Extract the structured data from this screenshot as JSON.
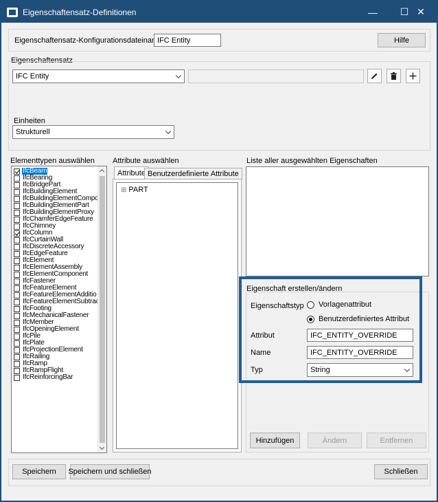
{
  "window": {
    "title": "Eigenschaftensatz-Definitionen",
    "minimize": "—",
    "maximize": "☐",
    "close": "✕"
  },
  "config": {
    "label": "Eigenschaftensatz-Konfigurationsdateiname",
    "value": "IFC Entity",
    "help_button": "Hilfe"
  },
  "propertyset": {
    "group_label": "Eigenschaftensatz",
    "selected": "IFC Entity",
    "text_value": ""
  },
  "units": {
    "group_label": "Einheiten",
    "selected": "Strukturell"
  },
  "element_types": {
    "label": "Elementtypen auswählen",
    "items": [
      {
        "name": "IfcBeam",
        "checked": true,
        "selected": true
      },
      {
        "name": "IfcBearing",
        "checked": false
      },
      {
        "name": "IfcBridgePart",
        "checked": false
      },
      {
        "name": "IfcBuildingElement",
        "checked": false
      },
      {
        "name": "IfcBuildingElementCompo",
        "checked": false
      },
      {
        "name": "IfcBuildingElementPart",
        "checked": false
      },
      {
        "name": "IfcBuildingElementProxy",
        "checked": false
      },
      {
        "name": "IfcChamferEdgeFeature",
        "checked": false
      },
      {
        "name": "IfcChimney",
        "checked": false
      },
      {
        "name": "IfcColumn",
        "checked": true
      },
      {
        "name": "IfcCurtainWall",
        "checked": false
      },
      {
        "name": "IfcDiscreteAccessory",
        "checked": false
      },
      {
        "name": "IfcEdgeFeature",
        "checked": false
      },
      {
        "name": "IfcElement",
        "checked": false
      },
      {
        "name": "IfcElementAssembly",
        "checked": false
      },
      {
        "name": "IfcElementComponent",
        "checked": false
      },
      {
        "name": "IfcFastener",
        "checked": false
      },
      {
        "name": "IfcFeatureElement",
        "checked": false
      },
      {
        "name": "IfcFeatureElementAdditio",
        "checked": false
      },
      {
        "name": "IfcFeatureElementSubtrac",
        "checked": false
      },
      {
        "name": "IfcFooting",
        "checked": false
      },
      {
        "name": "IfcMechanicalFastener",
        "checked": false
      },
      {
        "name": "IfcMember",
        "checked": false
      },
      {
        "name": "IfcOpeningElement",
        "checked": false
      },
      {
        "name": "IfcPile",
        "checked": false
      },
      {
        "name": "IfcPlate",
        "checked": false
      },
      {
        "name": "IfcProjectionElement",
        "checked": false
      },
      {
        "name": "IfcRailing",
        "checked": false
      },
      {
        "name": "IfcRamp",
        "checked": false
      },
      {
        "name": "IfcRampFlight",
        "checked": false
      },
      {
        "name": "IfcReinforcingBar",
        "checked": false
      }
    ]
  },
  "attributes": {
    "label": "Attribute auswählen",
    "tab_attribute": "Attribute",
    "tab_custom": "Benutzerdefinierte Attribute",
    "tree_expander": "⊞",
    "tree_root": "PART"
  },
  "selected_props": {
    "label": "Liste aller ausgewählten Eigenschaften"
  },
  "create_edit": {
    "group_label": "Eigenschaft erstellen/ändern",
    "type_label": "Eigenschaftstyp",
    "radio_template": "Vorlagenattribut",
    "radio_custom": "Benutzerdefiniertes Attribut",
    "attribute_label": "Attribut",
    "attribute_value": "IFC_ENTITY_OVERRIDE",
    "name_label": "Name",
    "name_value": "IFC_ENTITY_OVERRIDE",
    "typ_label": "Typ",
    "typ_value": "String",
    "add_button": "Hinzufügen",
    "change_button": "Ändern",
    "remove_button": "Entfernen"
  },
  "footer": {
    "save": "Speichern",
    "save_close": "Speichern und schließen",
    "close": "Schließen"
  },
  "colors": {
    "title_bar": "#1f4e79",
    "selection": "#0078d7",
    "highlight_border": "#1f5d99"
  }
}
